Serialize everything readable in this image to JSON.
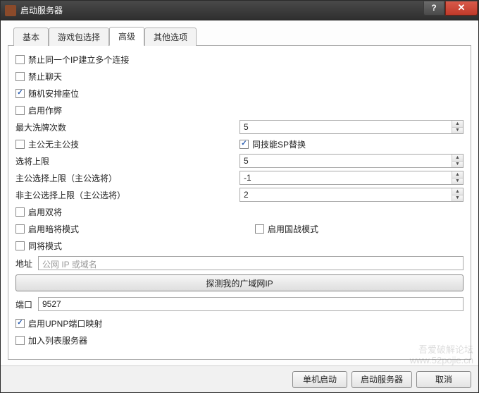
{
  "title": "启动服务器",
  "tabs": [
    {
      "label": "基本",
      "active": false
    },
    {
      "label": "游戏包选择",
      "active": false
    },
    {
      "label": "高级",
      "active": true
    },
    {
      "label": "其他选项",
      "active": false
    }
  ],
  "opts": {
    "forbid_same_ip": {
      "label": "禁止同一个IP建立多个连接",
      "checked": false
    },
    "forbid_chat": {
      "label": "禁止聊天",
      "checked": false
    },
    "random_seat": {
      "label": "随机安排座位",
      "checked": true
    },
    "enable_cheat": {
      "label": "启用作弊",
      "checked": false
    },
    "max_shuffle": {
      "label": "最大洗牌次数",
      "value": "5"
    },
    "lord_no_skill": {
      "label": "主公无主公技",
      "checked": false
    },
    "same_skill_sp": {
      "label": "同技能SP替换",
      "checked": true
    },
    "choose_general_limit": {
      "label": "选将上限",
      "value": "5"
    },
    "lord_choose_limit": {
      "label": "主公选择上限（主公选将）",
      "value": "-1"
    },
    "nonlord_choose_limit": {
      "label": "非主公选择上限（主公选将）",
      "value": "2"
    },
    "enable_dual": {
      "label": "启用双将",
      "checked": false
    },
    "enable_hidden": {
      "label": "启用暗将模式",
      "checked": false
    },
    "enable_kingdom": {
      "label": "启用国战模式",
      "checked": false
    },
    "same_general_mode": {
      "label": "同将模式",
      "checked": false
    }
  },
  "address": {
    "label": "地址",
    "placeholder": "公网 IP 或域名",
    "value": ""
  },
  "detect_button": "探测我的广域网IP",
  "port": {
    "label": "端口",
    "value": "9527"
  },
  "upnp": {
    "label": "启用UPNP端口映射",
    "checked": true
  },
  "add_list": {
    "label": "加入列表服务器",
    "checked": false
  },
  "footer": {
    "single": "单机启动",
    "start": "启动服务器",
    "cancel": "取消"
  },
  "watermark": {
    "line1": "吾爱破解论坛",
    "line2": "www.52pojie.cn"
  }
}
